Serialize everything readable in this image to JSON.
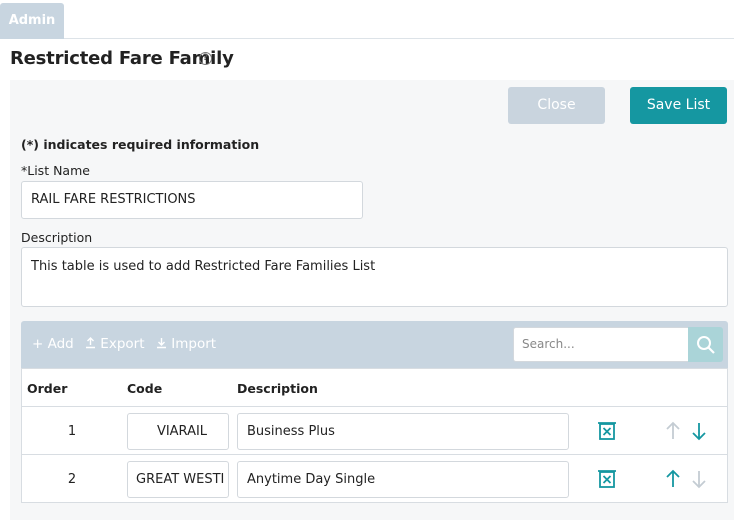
{
  "tabs": [
    {
      "label": "Admin"
    }
  ],
  "page": {
    "title": "Restricted Fare Family"
  },
  "buttons": {
    "close": "Close",
    "save": "Save List"
  },
  "form": {
    "required_note": "(*) indicates required information",
    "list_name_label": "*List Name",
    "list_name_value": "RAIL FARE RESTRICTIONS",
    "description_label": "Description",
    "description_value": "This table is used to add Restricted Fare Families List"
  },
  "toolbar": {
    "add": "+ Add",
    "export": "Export",
    "import": "Import",
    "search_placeholder": "Search..."
  },
  "table": {
    "headers": {
      "order": "Order",
      "code": "Code",
      "description": "Description"
    },
    "rows": [
      {
        "order": "1",
        "code": "VIARAIL",
        "description": "Business Plus"
      },
      {
        "order": "2",
        "code": "GREAT WESTI",
        "description": "Anytime Day Single"
      }
    ]
  },
  "colors": {
    "accent": "#1597a1",
    "muted": "#c8d5e0",
    "disabled_arrow": "#c4ccd3"
  }
}
